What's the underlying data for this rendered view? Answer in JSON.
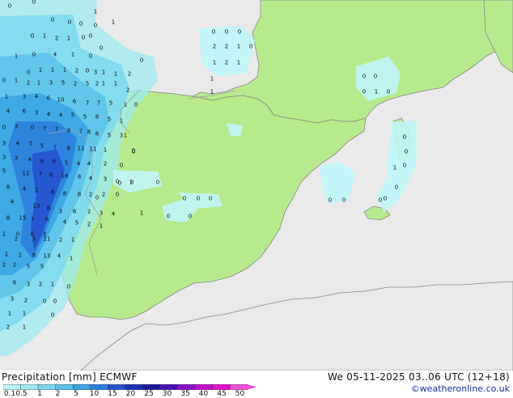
{
  "legend": {
    "title": "Precipitation [mm] ECMWF",
    "ticks": [
      "0.1",
      "0.5",
      "1",
      "2",
      "5",
      "10",
      "15",
      "20",
      "25",
      "30",
      "35",
      "40",
      "45",
      "50"
    ],
    "colors": [
      "#bff5f7",
      "#9eeaf2",
      "#7cd8ef",
      "#5cc2ea",
      "#3aa5e4",
      "#2c7fdc",
      "#2552cf",
      "#1e2fb7",
      "#1c1a98",
      "#4b12b8",
      "#8b10c8",
      "#c40fd0",
      "#e40fcf",
      "#f54fd9"
    ]
  },
  "timestamp": "We 05-11-2025 03..06 UTC (12+18)",
  "credit": "©weatheronline.co.uk",
  "colors": {
    "land": "#b7ea8c",
    "sea": "#e9e9e9",
    "outer_land": "#e9e9e9",
    "border": "#a0a0a0",
    "coast": "#8a8a8a"
  },
  "map_values": [
    {
      "t": "0"
    },
    {
      "t": "0"
    },
    {
      "t": "0"
    },
    {
      "t": "0"
    },
    {
      "t": "0"
    },
    {
      "t": "0"
    },
    {
      "t": "1"
    },
    {
      "t": "1"
    },
    {
      "t": "0"
    },
    {
      "t": "0"
    },
    {
      "t": "1"
    },
    {
      "t": "2"
    },
    {
      "t": "1"
    },
    {
      "t": "0"
    },
    {
      "t": "0"
    },
    {
      "t": "1"
    },
    {
      "t": "0"
    },
    {
      "t": "4"
    },
    {
      "t": "1"
    },
    {
      "t": "0"
    },
    {
      "t": "0"
    },
    {
      "t": "1"
    },
    {
      "t": "1"
    },
    {
      "t": "1"
    },
    {
      "t": "2"
    },
    {
      "t": "0"
    },
    {
      "t": "3"
    },
    {
      "t": "1"
    },
    {
      "t": "1"
    },
    {
      "t": "2"
    },
    {
      "t": "0"
    },
    {
      "t": "1"
    },
    {
      "t": "2"
    },
    {
      "t": "1"
    },
    {
      "t": "3"
    },
    {
      "t": "5"
    },
    {
      "t": "2"
    },
    {
      "t": "5"
    },
    {
      "t": "2"
    },
    {
      "t": "1"
    },
    {
      "t": "1"
    },
    {
      "t": "2"
    },
    {
      "t": "1"
    },
    {
      "t": "3"
    },
    {
      "t": "4"
    },
    {
      "t": "6"
    },
    {
      "t": "10"
    },
    {
      "t": "6"
    },
    {
      "t": "7"
    },
    {
      "t": "7"
    },
    {
      "t": "5"
    },
    {
      "t": "1"
    },
    {
      "t": "0"
    },
    {
      "t": "4"
    },
    {
      "t": "6"
    },
    {
      "t": "3"
    },
    {
      "t": "4"
    },
    {
      "t": "4"
    },
    {
      "t": "5"
    },
    {
      "t": "5"
    },
    {
      "t": "8"
    },
    {
      "t": "5"
    },
    {
      "t": "1"
    },
    {
      "t": "0"
    },
    {
      "t": "3"
    },
    {
      "t": "0"
    },
    {
      "t": "7"
    },
    {
      "t": "7"
    },
    {
      "t": "8"
    },
    {
      "t": "7"
    },
    {
      "t": "8"
    },
    {
      "t": "6"
    },
    {
      "t": "5"
    },
    {
      "t": "3"
    },
    {
      "t": "1"
    },
    {
      "t": "3"
    },
    {
      "t": "4"
    },
    {
      "t": "5"
    },
    {
      "t": "5"
    },
    {
      "t": "7"
    },
    {
      "t": "6"
    },
    {
      "t": "11"
    },
    {
      "t": "11"
    },
    {
      "t": "1"
    },
    {
      "t": "0"
    },
    {
      "t": "3"
    },
    {
      "t": "3"
    },
    {
      "t": "4"
    },
    {
      "t": "8"
    },
    {
      "t": "6"
    },
    {
      "t": "5"
    },
    {
      "t": "4"
    },
    {
      "t": "4"
    },
    {
      "t": "2"
    },
    {
      "t": "0"
    },
    {
      "t": "5"
    },
    {
      "t": "11"
    },
    {
      "t": "7"
    },
    {
      "t": "8"
    },
    {
      "t": "16"
    },
    {
      "t": "8"
    },
    {
      "t": "4"
    },
    {
      "t": "3"
    },
    {
      "t": "0"
    },
    {
      "t": "1"
    },
    {
      "t": "0"
    },
    {
      "t": "8"
    },
    {
      "t": "4"
    },
    {
      "t": "2"
    },
    {
      "t": "6"
    },
    {
      "t": "8"
    },
    {
      "t": "8"
    },
    {
      "t": "2"
    },
    {
      "t": "2"
    },
    {
      "t": "0"
    },
    {
      "t": "4"
    },
    {
      "t": "13"
    },
    {
      "t": "8"
    },
    {
      "t": "3"
    },
    {
      "t": "8"
    },
    {
      "t": "2"
    },
    {
      "t": "3"
    },
    {
      "t": "4"
    },
    {
      "t": "8"
    },
    {
      "t": "15"
    },
    {
      "t": "7"
    },
    {
      "t": "6"
    },
    {
      "t": "4"
    },
    {
      "t": "5"
    },
    {
      "t": "2"
    },
    {
      "t": "1"
    },
    {
      "t": "1"
    },
    {
      "t": "0"
    },
    {
      "t": "6"
    },
    {
      "t": "3"
    },
    {
      "t": "2"
    },
    {
      "t": "3"
    },
    {
      "t": "21"
    },
    {
      "t": "2"
    },
    {
      "t": "1"
    },
    {
      "t": "1"
    },
    {
      "t": "1"
    },
    {
      "t": "8"
    },
    {
      "t": "13"
    },
    {
      "t": "4"
    },
    {
      "t": "1"
    },
    {
      "t": "2"
    },
    {
      "t": "2"
    },
    {
      "t": "5"
    },
    {
      "t": "5"
    },
    {
      "t": "6"
    },
    {
      "t": "3"
    },
    {
      "t": "2"
    },
    {
      "t": "1"
    },
    {
      "t": "0"
    },
    {
      "t": "3"
    },
    {
      "t": "2"
    },
    {
      "t": "0"
    },
    {
      "t": "0"
    },
    {
      "t": "1"
    },
    {
      "t": "1"
    },
    {
      "t": "0"
    },
    {
      "t": "2"
    },
    {
      "t": "1"
    },
    {
      "t": "0"
    },
    {
      "t": "0"
    },
    {
      "t": "0"
    },
    {
      "t": "1"
    },
    {
      "t": "0"
    },
    {
      "t": "0"
    },
    {
      "t": "0"
    },
    {
      "t": "0"
    },
    {
      "t": "0"
    },
    {
      "t": "0"
    },
    {
      "t": "0"
    },
    {
      "t": "2"
    },
    {
      "t": "2"
    },
    {
      "t": "1"
    },
    {
      "t": "0"
    },
    {
      "t": "1"
    },
    {
      "t": "2"
    },
    {
      "t": "1"
    },
    {
      "t": "1"
    },
    {
      "t": "1"
    },
    {
      "t": "0"
    },
    {
      "t": "0"
    },
    {
      "t": "0"
    },
    {
      "t": "1"
    },
    {
      "t": "0"
    },
    {
      "t": "0"
    },
    {
      "t": "0"
    },
    {
      "t": "1"
    },
    {
      "t": "0"
    },
    {
      "t": "0"
    },
    {
      "t": "0"
    },
    {
      "t": "0"
    },
    {
      "t": "0"
    },
    {
      "t": "0"
    },
    {
      "t": "0"
    },
    {
      "t": "0"
    },
    {
      "t": "0"
    }
  ]
}
